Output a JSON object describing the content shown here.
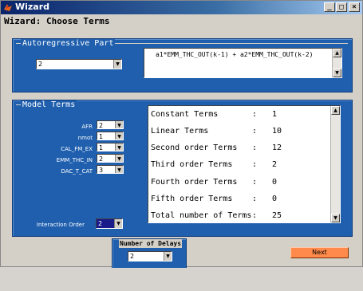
{
  "window": {
    "title": "Wizard",
    "minimize": "_",
    "maximize": "□",
    "close": "×"
  },
  "page_heading": "Wizard: Choose Terms",
  "autoregressive": {
    "title": "Autoregressive Part",
    "order_value": "2",
    "equation": "a1*EMM_THC_OUT(k-1) + a2*EMM_THC_OUT(k-2)"
  },
  "model_terms": {
    "title": "Model Terms",
    "inputs": [
      {
        "label": "AFR",
        "value": "2"
      },
      {
        "label": "nmot",
        "value": "1"
      },
      {
        "label": "CAL_FM_EX",
        "value": "1"
      },
      {
        "label": "EMM_THC_IN",
        "value": "2"
      },
      {
        "label": "DAC_T_CAT",
        "value": "3"
      }
    ],
    "interaction_label": "Interaction Order",
    "interaction_value": "2",
    "terms": [
      {
        "label": "Constant Terms",
        "colon": ":",
        "value": "1"
      },
      {
        "label": "Linear Terms",
        "colon": ":",
        "value": "10"
      },
      {
        "label": "Second order Terms",
        "colon": ":",
        "value": "12"
      },
      {
        "label": "Third order Terms",
        "colon": ":",
        "value": "2"
      },
      {
        "label": "Fourth order Terms",
        "colon": ":",
        "value": "0"
      },
      {
        "label": "Fifth order Terms",
        "colon": ":",
        "value": "0"
      },
      {
        "label": "Total number of Terms",
        "colon": ":",
        "value": "25"
      }
    ]
  },
  "delays": {
    "title": "Number of Delays",
    "value": "2"
  },
  "next_label": "Next",
  "colors": {
    "panel": "#1f5fae",
    "next_button": "#ff8a4c",
    "titlebar": "#0a246a"
  }
}
